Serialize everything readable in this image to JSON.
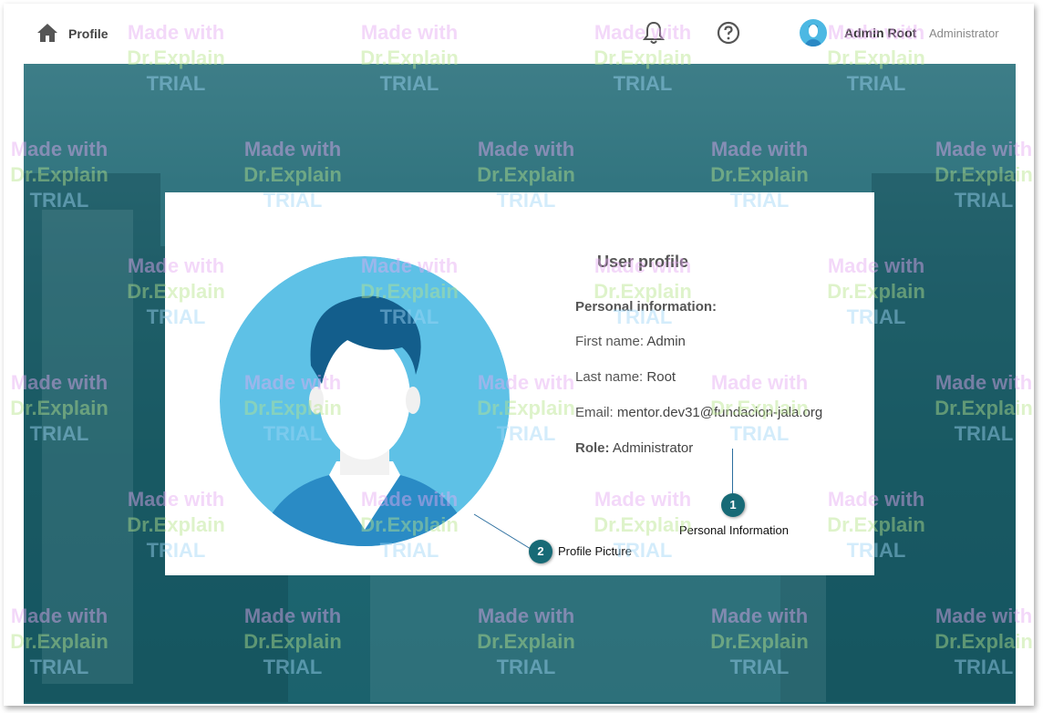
{
  "topbar": {
    "profile_link": "Profile",
    "user_name": "Admin Root",
    "user_role": "Administrator",
    "icons": [
      "home-icon",
      "bell-icon",
      "help-icon",
      "avatar"
    ]
  },
  "card": {
    "title": "User profile",
    "section": "Personal information:",
    "fields": [
      {
        "label": "First name:",
        "value": "Admin"
      },
      {
        "label": "Last name:",
        "value": "Root"
      },
      {
        "label": "Email:",
        "value": "mentor.dev31@fundacion-jala.org"
      },
      {
        "label": "Role:",
        "value": "Administrator"
      }
    ]
  },
  "callouts": [
    {
      "number": "1",
      "label": "Personal Information"
    },
    {
      "number": "2",
      "label": "Profile Picture"
    }
  ],
  "watermark": {
    "line1": "Made with",
    "line2": "Dr.Explain",
    "line3": "TRIAL"
  },
  "colors": {
    "accent": "#176a76",
    "avatar_blue": "#4cb8e3",
    "background_tint": "#2f6a73"
  }
}
